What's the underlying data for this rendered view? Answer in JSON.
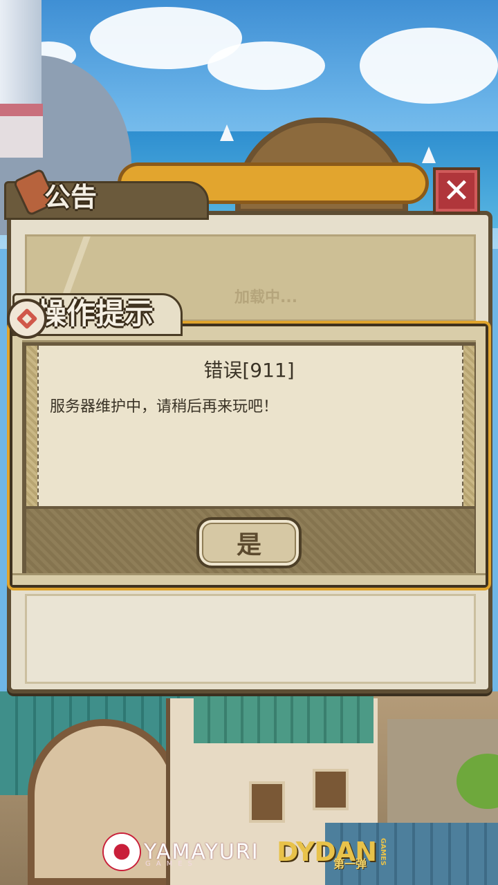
{
  "notice": {
    "title": "公告",
    "loading_text": "加载中...",
    "close_glyph": "✕"
  },
  "dialog": {
    "title": "操作提示",
    "error_title": "错误[911]",
    "error_message": "服务器维护中，请稍后再来玩吧！",
    "confirm_label": "是"
  },
  "logos": {
    "publisher": "YAMAYURI",
    "publisher_sub": "GAMES",
    "developer": "DYDAN",
    "developer_sub": "第一弹",
    "developer_side": "GAMES"
  },
  "colors": {
    "panel_frame": "#5e4e34",
    "panel_bg": "#e6dfcc",
    "close_button": "#b0363b",
    "dialog_border_accent": "#e0a42c",
    "text": "#3a3326"
  }
}
